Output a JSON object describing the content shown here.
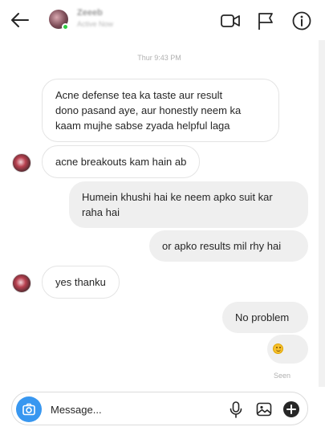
{
  "header": {
    "contact_name": "Zeeeb",
    "contact_status": "Active Now"
  },
  "icons": {
    "back": "arrow-left-icon",
    "video": "video-camera-icon",
    "flag": "flag-icon",
    "info": "info-icon",
    "camera": "camera-icon",
    "mic": "microphone-icon",
    "image": "image-icon",
    "plus": "plus-icon"
  },
  "chat": {
    "timestamp": "Thur 9:43 PM",
    "messages": [
      {
        "direction": "incoming",
        "lines": [
          "Acne defense tea ka taste aur result",
          "dono pasand aye, aur honestly neem ka",
          "kaam mujhe sabse zyada helpful laga"
        ]
      },
      {
        "direction": "incoming",
        "lines": [
          "acne breakouts kam hain ab"
        ]
      },
      {
        "direction": "outgoing",
        "lines": [
          "Humein khushi hai ke neem apko suit kar",
          "raha hai"
        ]
      },
      {
        "direction": "outgoing",
        "lines": [
          "or apko results mil rhy hai"
        ]
      },
      {
        "direction": "incoming",
        "lines": [
          "yes thanku"
        ]
      },
      {
        "direction": "outgoing",
        "lines": [
          "No problem"
        ]
      },
      {
        "direction": "outgoing",
        "emoji": "smiling-face-emoji"
      }
    ],
    "seen_label": "Seen"
  },
  "composer": {
    "placeholder": "Message..."
  },
  "colors": {
    "accent": "#3897f0",
    "outgoing_bubble": "#efefef",
    "online": "#2ecc40"
  }
}
